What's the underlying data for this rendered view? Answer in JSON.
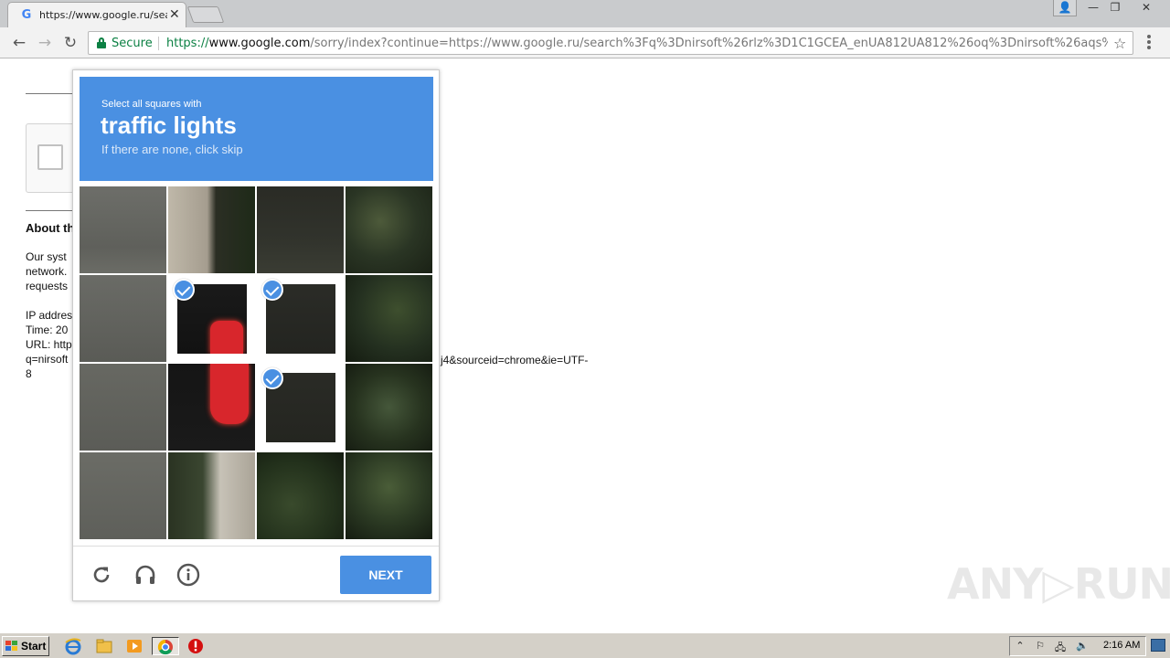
{
  "browser": {
    "tab_title": "https://www.google.ru/search?q=nirsoft",
    "tab_favicon": "G",
    "url_scheme": "https://",
    "url_host": "www.google.com",
    "url_rest": "/sorry/index?continue=https://www.google.ru/search%3Fq%3Dnirsoft%26rlz%3D1C1GCEA_enUA812UA812%26oq%3Dnirsoft%26aqs%...",
    "secure_label": "Secure"
  },
  "page": {
    "heading": "About th",
    "para_lines": [
      "Our syst",
      "network.",
      "requests"
    ],
    "info_lines": [
      "IP addres",
      "Time: 20",
      "URL: http",
      "q=nirsoft",
      "8"
    ],
    "url_tail": "j4&sourceid=chrome&ie=UTF-"
  },
  "captcha": {
    "prefix": "Select all squares with",
    "object": "traffic lights",
    "hint": "If there are none, click skip",
    "next_label": "NEXT",
    "selected_cells": [
      5,
      6,
      10
    ],
    "colors": {
      "header": "#4a90e2",
      "button": "#4a90e2",
      "light": "#d8262c"
    }
  },
  "watermark": "ANY▷RUN",
  "taskbar": {
    "start_label": "Start",
    "clock": "2:16 AM"
  }
}
